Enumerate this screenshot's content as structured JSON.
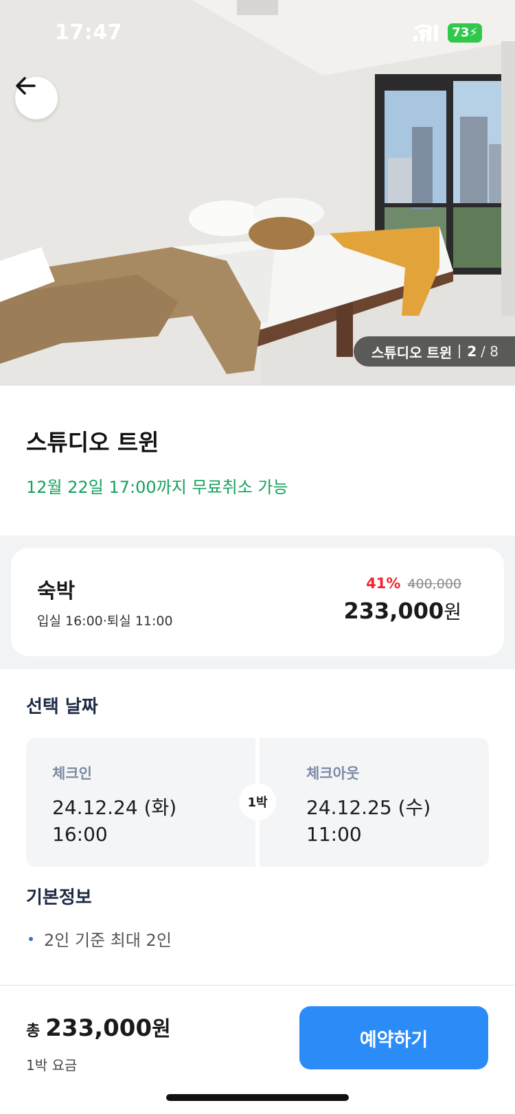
{
  "status_bar": {
    "time": "17:47",
    "battery": "73"
  },
  "hero": {
    "photo_caption": "스튜디오 트윈",
    "photo_index": "2",
    "photo_total": "/ 8"
  },
  "room": {
    "title": "스튜디오 트윈",
    "cancel_note": "12월 22일 17:00까지 무료취소 가능"
  },
  "price_card": {
    "stay_type": "숙박",
    "stay_time": "입실 16:00·퇴실 11:00",
    "discount": "41%",
    "original_price": "400,000",
    "final_price": "233,000",
    "currency": "원"
  },
  "dates": {
    "section_title": "선택 날짜",
    "checkin_label": "체크인",
    "checkin_date": "24.12.24 (화)",
    "checkin_time": "16:00",
    "nights": "1박",
    "checkout_label": "체크아웃",
    "checkout_date": "24.12.25 (수)",
    "checkout_time": "11:00"
  },
  "basic_info": {
    "section_title": "기본정보",
    "items": [
      "2인 기준 최대 2인"
    ]
  },
  "bottom_bar": {
    "total_prefix": "총",
    "total_amount": "233,000",
    "total_currency": "원",
    "sub_label": "1박 요금",
    "reserve_label": "예약하기"
  },
  "colors": {
    "accent_blue": "#2b8cf8",
    "cancel_green": "#13a05c",
    "discount_red": "#f0262d"
  }
}
